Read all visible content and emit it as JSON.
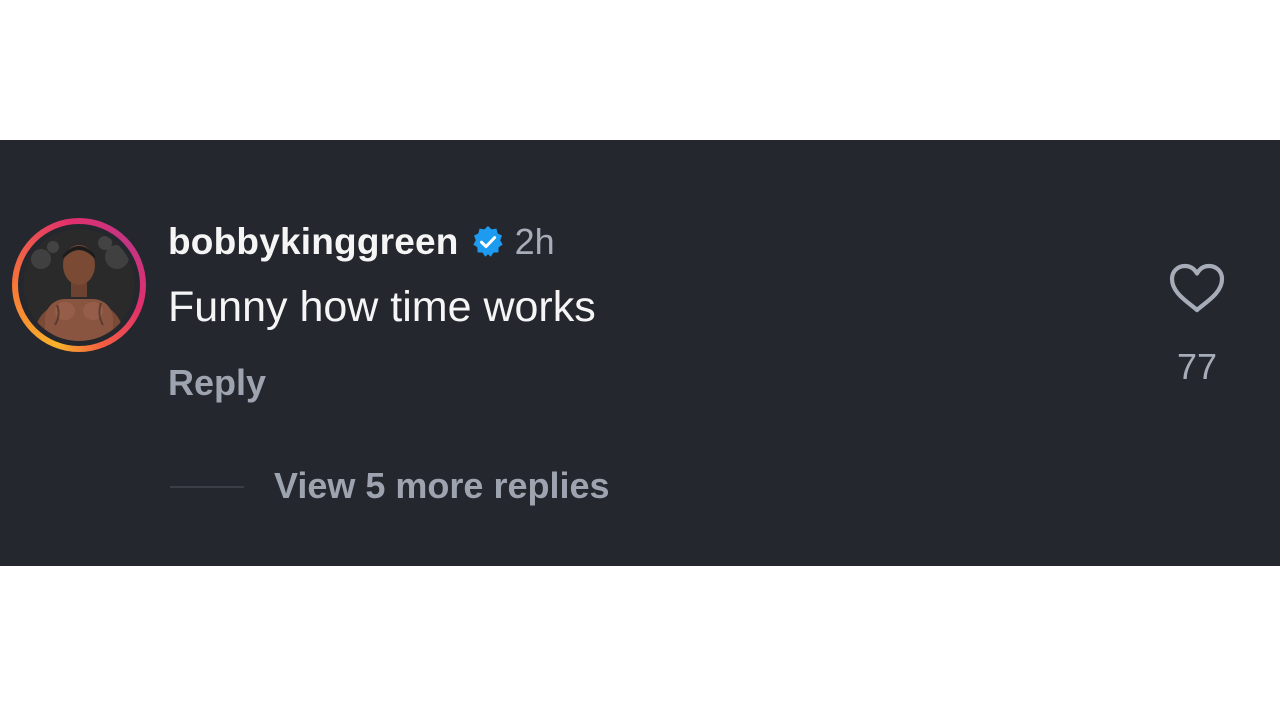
{
  "comment": {
    "username": "bobbykinggreen",
    "verified_icon": "verified-badge-icon",
    "timestamp": "2h",
    "text": "Funny how time works",
    "reply_label": "Reply",
    "like_icon": "heart-icon",
    "like_count": "77",
    "view_replies_label": "View 5 more replies"
  },
  "colors": {
    "background": "#25272e",
    "primary_text": "#f5f5f5",
    "secondary_text": "#9ea4af",
    "verified_blue": "#1d9bf0"
  }
}
